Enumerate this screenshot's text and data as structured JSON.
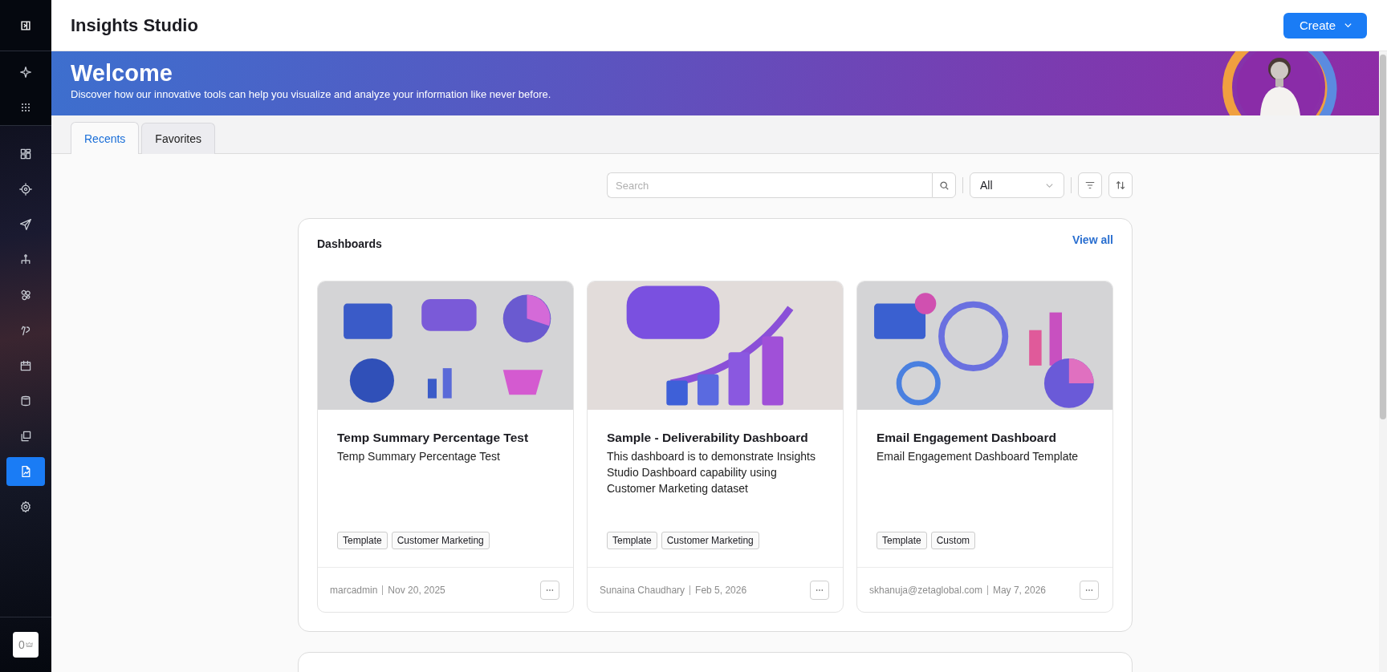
{
  "sidebar": {
    "groups": [
      {
        "items": [
          {
            "selected": false
          },
          {
            "selected": false
          }
        ]
      },
      {
        "items": [
          {
            "selected": false
          },
          {
            "selected": false
          },
          {
            "selected": false
          },
          {
            "selected": false
          },
          {
            "selected": false
          },
          {
            "selected": false
          },
          {
            "selected": false
          },
          {
            "selected": false
          },
          {
            "selected": false
          },
          {
            "selected": true
          },
          {
            "selected": false
          }
        ]
      }
    ],
    "badge": {
      "count": "0"
    }
  },
  "header": {
    "title": "Insights Studio",
    "create_button": "Create"
  },
  "banner": {
    "title": "Welcome",
    "subtitle": "Discover how our innovative tools can help you visualize and analyze your information like never before."
  },
  "tabs": [
    {
      "label": "Recents",
      "selected": true
    },
    {
      "label": "Favorites",
      "selected": false
    }
  ],
  "toolbar": {
    "search": {
      "placeholder": "Search"
    },
    "filter": {
      "value": "All"
    }
  },
  "sections": [
    {
      "title": "Dashboards",
      "link": "View all",
      "cards": [
        {
          "title": "Temp Summary Percentage Test",
          "description": "Temp Summary Percentage Test",
          "tags": [
            "Template",
            "Customer Marketing"
          ],
          "author": "marcadmin",
          "date": "Nov 20, 2025"
        },
        {
          "title": "Sample - Deliverability Dashboard",
          "description": "This dashboard is to demonstrate Insights Studio Dashboard capability using Customer Marketing dataset",
          "tags": [
            "Template",
            "Customer Marketing"
          ],
          "author": "Sunaina Chaudhary",
          "date": "Feb 5, 2026"
        },
        {
          "title": "Email Engagement Dashboard",
          "description": "Email Engagement Dashboard Template",
          "tags": [
            "Template",
            "Custom"
          ],
          "author": "skhanuja@zetaglobal.com",
          "date": "May 7, 2026"
        }
      ]
    }
  ]
}
